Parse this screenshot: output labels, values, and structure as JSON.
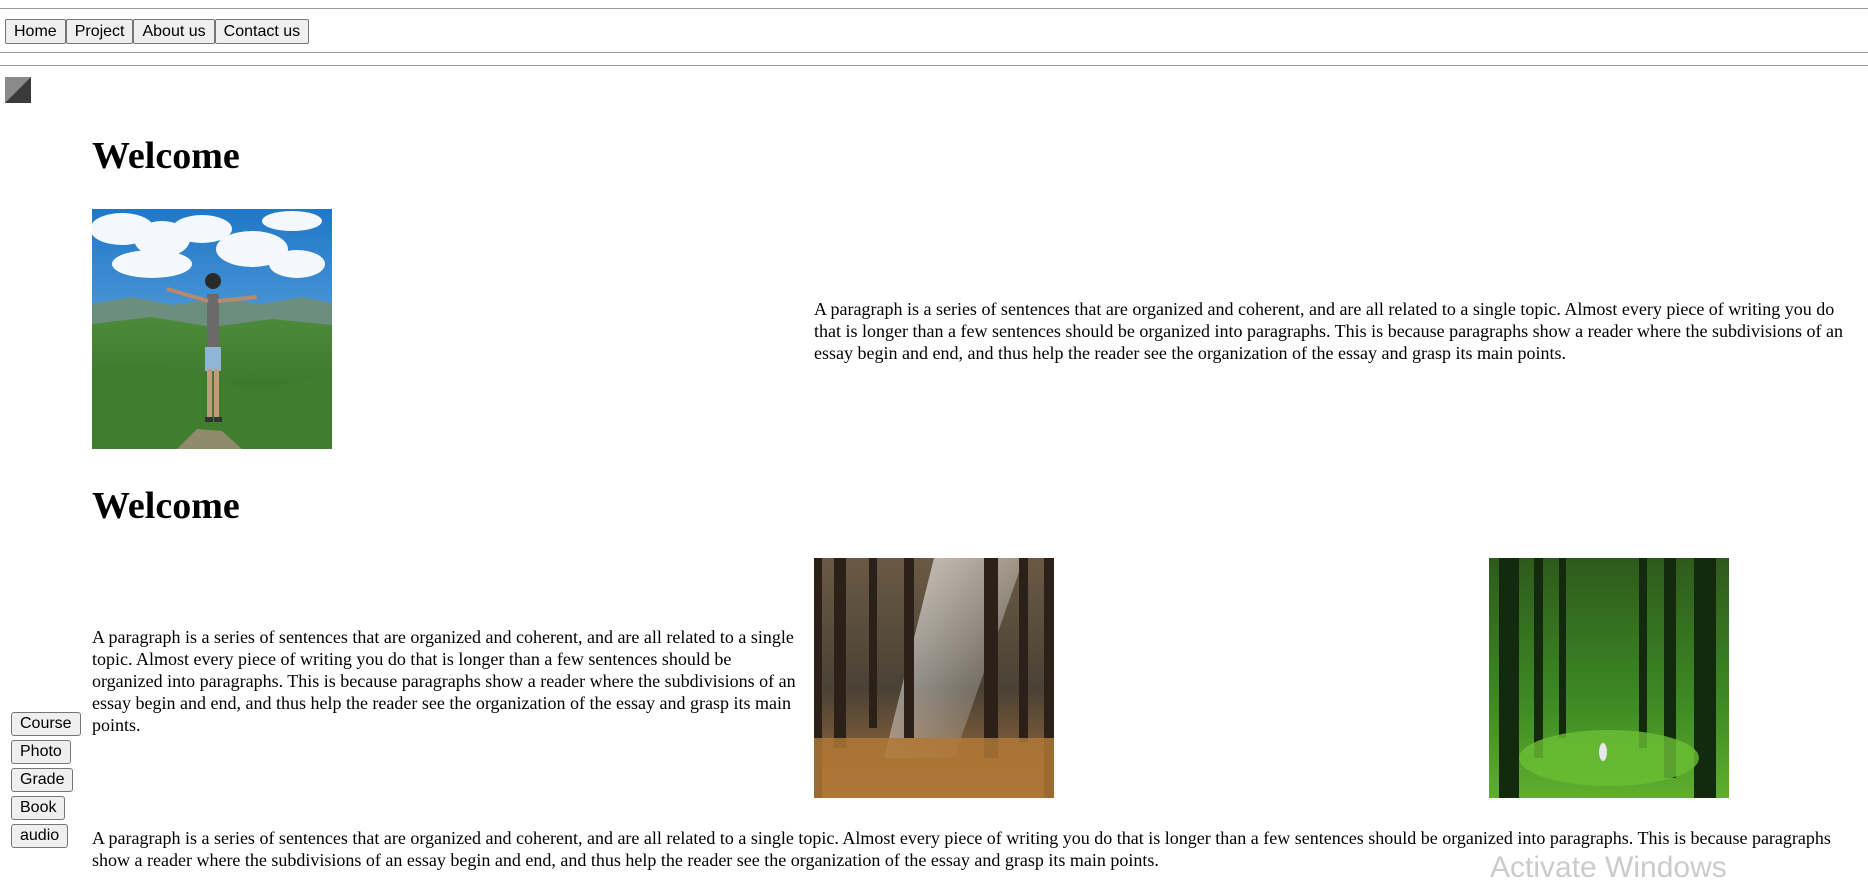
{
  "nav": {
    "items": [
      {
        "label": "Home"
      },
      {
        "label": "Project"
      },
      {
        "label": "About us"
      },
      {
        "label": "Contact us"
      }
    ]
  },
  "section1": {
    "heading": "Welcome",
    "paragraph": "A paragraph is a series of sentences that are organized and coherent, and are all related to a single topic. Almost every piece of writing you do that is longer than a few sentences should be organized into paragraphs. This is because paragraphs show a reader where the subdivisions of an essay begin and end, and thus help the reader see the organization of the essay and grasp its main points."
  },
  "section2": {
    "heading": "Welcome",
    "paragraph": "A paragraph is a series of sentences that are organized and coherent, and are all related to a single topic. Almost every piece of writing you do that is longer than a few sentences should be organized into paragraphs. This is because paragraphs show a reader where the subdivisions of an essay begin and end, and thus help the reader see the organization of the essay and grasp its main points."
  },
  "section3": {
    "paragraph": "A paragraph is a series of sentences that are organized and coherent, and are all related to a single topic. Almost every piece of writing you do that is longer than a few sentences should be organized into paragraphs. This is because paragraphs show a reader where the subdivisions of an essay begin and end, and thus help the reader see the organization of the essay and grasp its main points."
  },
  "sidebar": {
    "buttons": [
      {
        "label": "Course"
      },
      {
        "label": "Photo"
      },
      {
        "label": "Grade"
      },
      {
        "label": "Book"
      },
      {
        "label": "audio"
      }
    ]
  },
  "watermark": {
    "text": "Activate Windows"
  }
}
